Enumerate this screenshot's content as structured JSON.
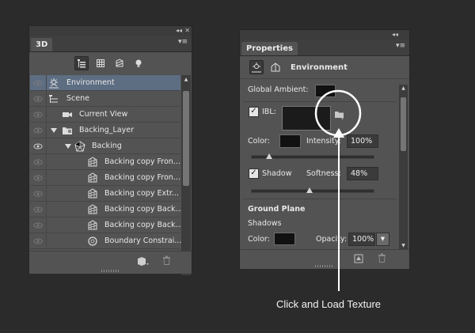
{
  "panel_3d": {
    "tab_label": "3D",
    "collapse_glyph": "◂◂",
    "menu_glyph": "▾≡",
    "close_glyph": "✕",
    "filter_icons": [
      "scene-filter-icon",
      "mesh-filter-icon",
      "material-filter-icon",
      "light-filter-icon"
    ],
    "layers": [
      {
        "label": "Environment",
        "icon": "environment-icon",
        "selected": true
      },
      {
        "label": "Scene",
        "icon": "scene-icon"
      },
      {
        "label": "Current View",
        "icon": "camera-icon"
      },
      {
        "label": "Backing_Layer",
        "icon": "folder-icon"
      },
      {
        "label": "Backing",
        "icon": "mesh-group-icon"
      },
      {
        "label": "Backing copy Fron...",
        "icon": "mesh-icon"
      },
      {
        "label": "Backing copy Fron...",
        "icon": "mesh-icon"
      },
      {
        "label": "Backing copy Extr...",
        "icon": "mesh-icon"
      },
      {
        "label": "Backing copy Back...",
        "icon": "mesh-icon"
      },
      {
        "label": "Backing copy Back...",
        "icon": "mesh-icon"
      },
      {
        "label": "Boundary Constrai...",
        "icon": "constraint-icon"
      }
    ]
  },
  "properties": {
    "tab_label": "Properties",
    "collapse_glyph": "◂◂",
    "menu_glyph": "▾≡",
    "header_label": "Environment",
    "global_ambient_label": "Global Ambient:",
    "ibl_label": "IBL:",
    "color_label": "Color:",
    "intensity_label": "Intensity:",
    "intensity_value": "100%",
    "shadow_label": "Shadow",
    "softness_label": "Softness:",
    "softness_value": "48%",
    "ground_plane_label": "Ground Plane",
    "shadows_label": "Shadows",
    "ground_color_label": "Color:",
    "opacity_label": "Opacity:",
    "opacity_value": "100%"
  },
  "annotation": {
    "text": "Click and Load Texture"
  },
  "colors": {
    "background": "#2b2b2b",
    "panel": "#535353",
    "selected_row": "#5d6d82",
    "annotation": "#ffffff"
  }
}
